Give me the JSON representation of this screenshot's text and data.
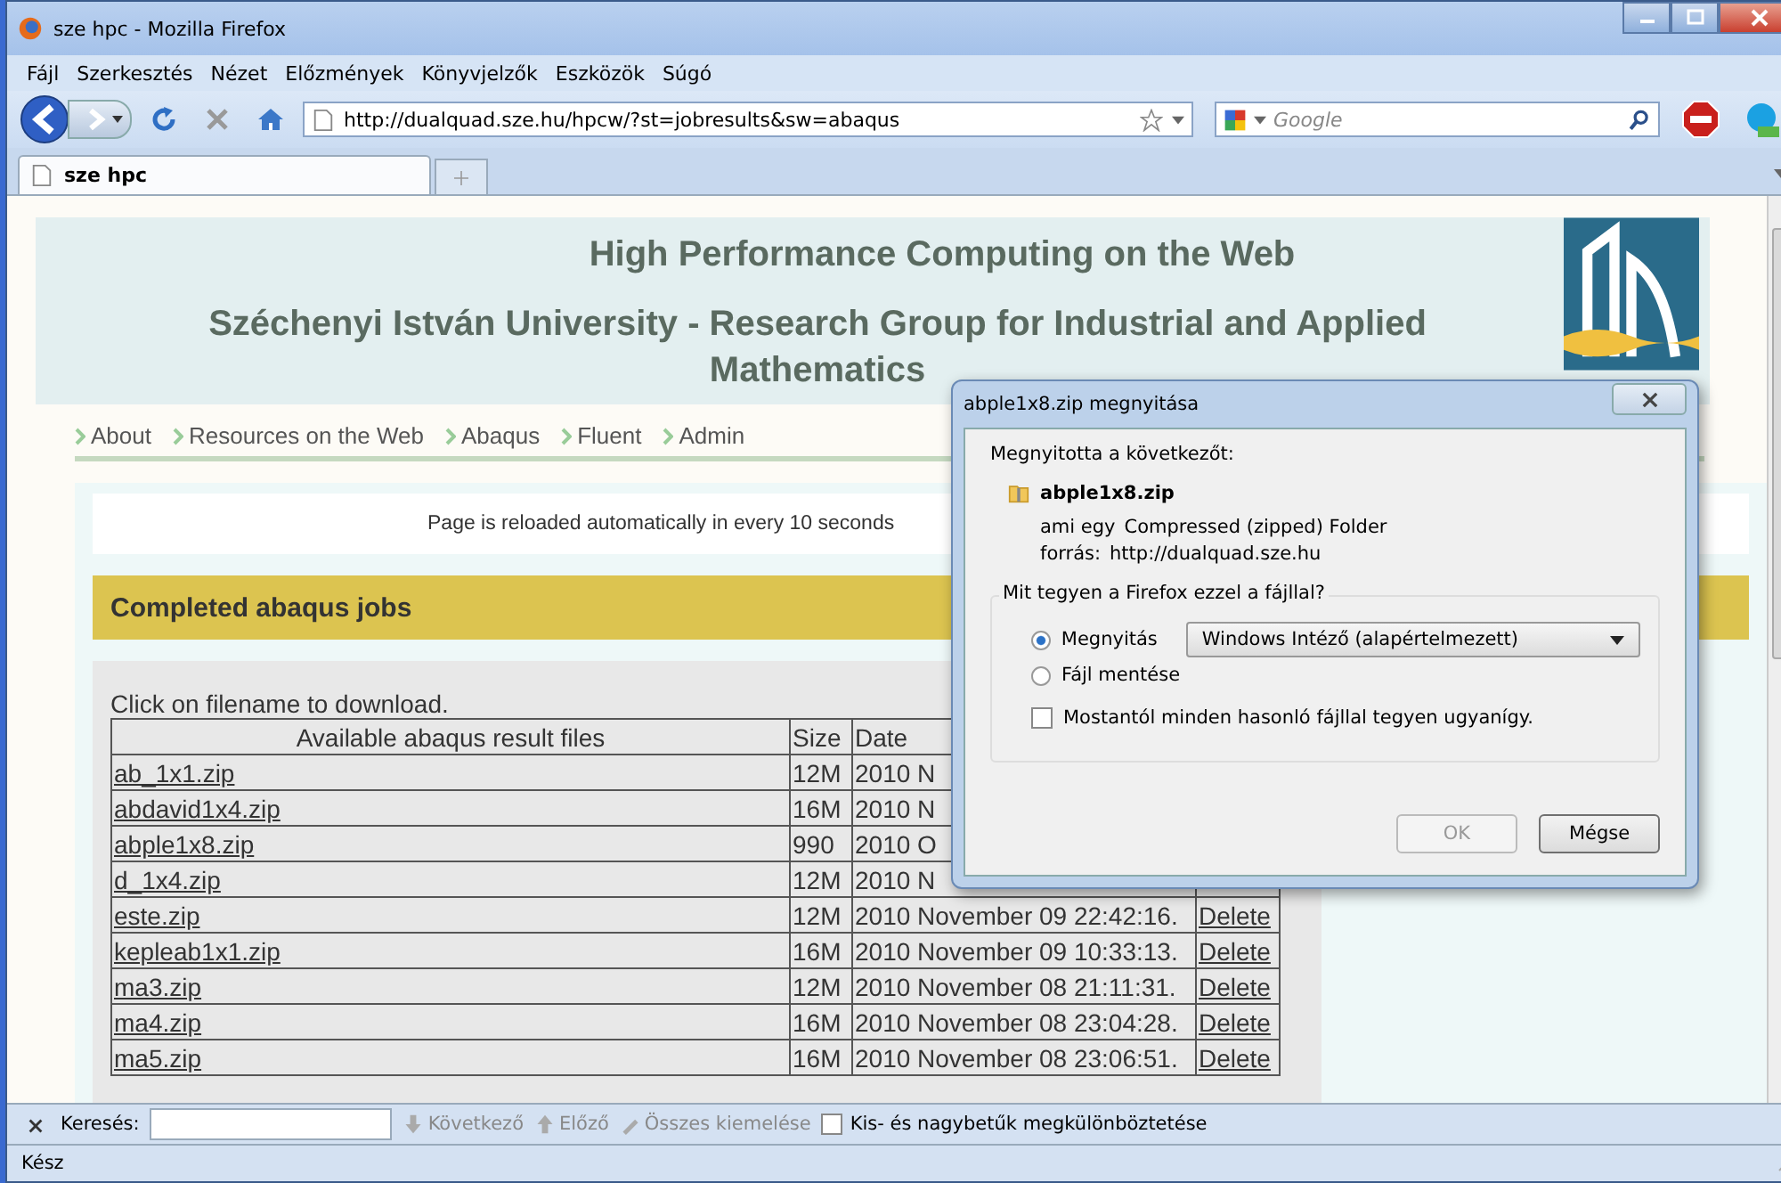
{
  "window": {
    "title": "sze hpc - Mozilla Firefox"
  },
  "menu": [
    "Fájl",
    "Szerkesztés",
    "Nézet",
    "Előzmények",
    "Könyvjelzők",
    "Eszközök",
    "Súgó"
  ],
  "toolbar": {
    "url": "http://dualquad.sze.hu/hpcw/?st=jobresults&sw=abaqus",
    "search_placeholder": "Google"
  },
  "tabs": [
    {
      "label": "sze hpc",
      "selected": true
    }
  ],
  "page": {
    "title": "High Performance Computing on the Web",
    "subtitle": "Széchenyi István University - Research Group for Industrial and Applied Mathematics",
    "nav": [
      "About",
      "Resources on the Web",
      "Abaqus",
      "Fluent",
      "Admin"
    ],
    "notice": "Page is reloaded automatically in every 10 seconds",
    "section_title": "Completed abaqus jobs",
    "instruction": "Click on filename to download.",
    "table": {
      "columns": [
        "Available abaqus result files",
        "Size",
        "Date"
      ],
      "rows": [
        {
          "file": "ab_1x1.zip",
          "size": "12M",
          "date": "2010 N"
        },
        {
          "file": "abdavid1x4.zip",
          "size": "16M",
          "date": "2010 N"
        },
        {
          "file": "abple1x8.zip",
          "size": "990",
          "date": "2010 O"
        },
        {
          "file": "d_1x4.zip",
          "size": "12M",
          "date": "2010 N"
        },
        {
          "file": "este.zip",
          "size": "12M",
          "date": "2010 November 09 22:42:16.",
          "action": "Delete"
        },
        {
          "file": "kepleab1x1.zip",
          "size": "16M",
          "date": "2010 November 09 10:33:13.",
          "action": "Delete"
        },
        {
          "file": "ma3.zip",
          "size": "12M",
          "date": "2010 November 08 21:11:31.",
          "action": "Delete"
        },
        {
          "file": "ma4.zip",
          "size": "16M",
          "date": "2010 November 08 23:04:28.",
          "action": "Delete"
        },
        {
          "file": "ma5.zip",
          "size": "16M",
          "date": "2010 November 08 23:06:51.",
          "action": "Delete"
        }
      ]
    }
  },
  "dialog": {
    "title": "abple1x8.zip megnyitása",
    "intro": "Megnyitotta a következőt:",
    "file": "abple1x8.zip",
    "type_label": "ami egy",
    "type": "Compressed (zipped) Folder",
    "source_label": "forrás:",
    "source": "http://dualquad.sze.hu",
    "question": "Mit tegyen a Firefox ezzel a fájllal?",
    "options": [
      {
        "label": "Megnyitás",
        "selected": true
      },
      {
        "label": "Fájl mentése",
        "selected": false
      }
    ],
    "app": "Windows Intéző (alapértelmezett)",
    "remember": {
      "label": "Mostantól minden hasonló fájllal tegyen ugyanígy.",
      "checked": false
    },
    "buttons": [
      {
        "label": "OK",
        "disabled": true
      },
      {
        "label": "Mégse",
        "disabled": false
      }
    ]
  },
  "find_bar": {
    "label": "Keresés:",
    "buttons": [
      {
        "label": "Következő",
        "disabled": true
      },
      {
        "label": "Előző",
        "disabled": true
      },
      {
        "label": "Összes kiemelése",
        "disabled": true
      }
    ],
    "match_case": {
      "label": "Kis- és nagybetűk megkülönböztetése",
      "checked": false
    }
  },
  "status_bar": "Kész"
}
